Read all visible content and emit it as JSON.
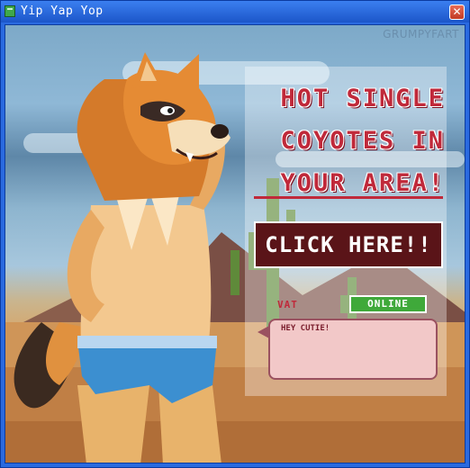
{
  "window": {
    "title": "Yip Yap Yop",
    "close_label": "✕",
    "icons": [
      "app-icon",
      "close-icon"
    ]
  },
  "watermark": "GRUMPYFART",
  "ad": {
    "headline": "HOT SINGLE\nCOYOTES IN\nYOUR AREA!",
    "cta_label": "CLICK HERE!!",
    "username": "VAT",
    "status": "ONLINE",
    "message": "HEY CUTIE!",
    "colors": {
      "headline": "#c0293a",
      "cta_bg": "#5a1418",
      "online_green": "#3fa93a",
      "chat_bg": "#f2c8c8"
    }
  }
}
